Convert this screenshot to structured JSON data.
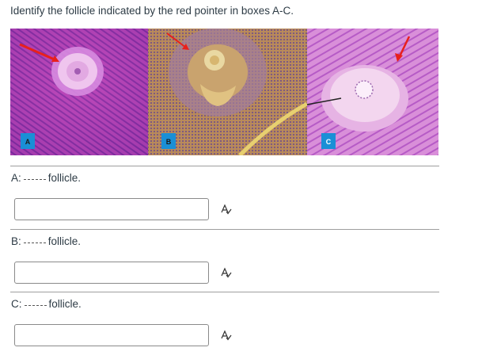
{
  "prompt": "Identify the follicle indicated by the red pointer in boxes A-C.",
  "figure": {
    "panel_labels": [
      "A",
      "B",
      "C"
    ],
    "label_badge_color": "#1a8fd6",
    "pointer_color": "#e8201c"
  },
  "questions": [
    {
      "letter": "A:",
      "suffix": "follicle.",
      "value": "",
      "placeholder": ""
    },
    {
      "letter": "B:",
      "suffix": "follicle.",
      "value": "",
      "placeholder": ""
    },
    {
      "letter": "C:",
      "suffix": "follicle.",
      "value": "",
      "placeholder": ""
    }
  ],
  "icons": {
    "spellcheck": "spellcheck-icon"
  }
}
